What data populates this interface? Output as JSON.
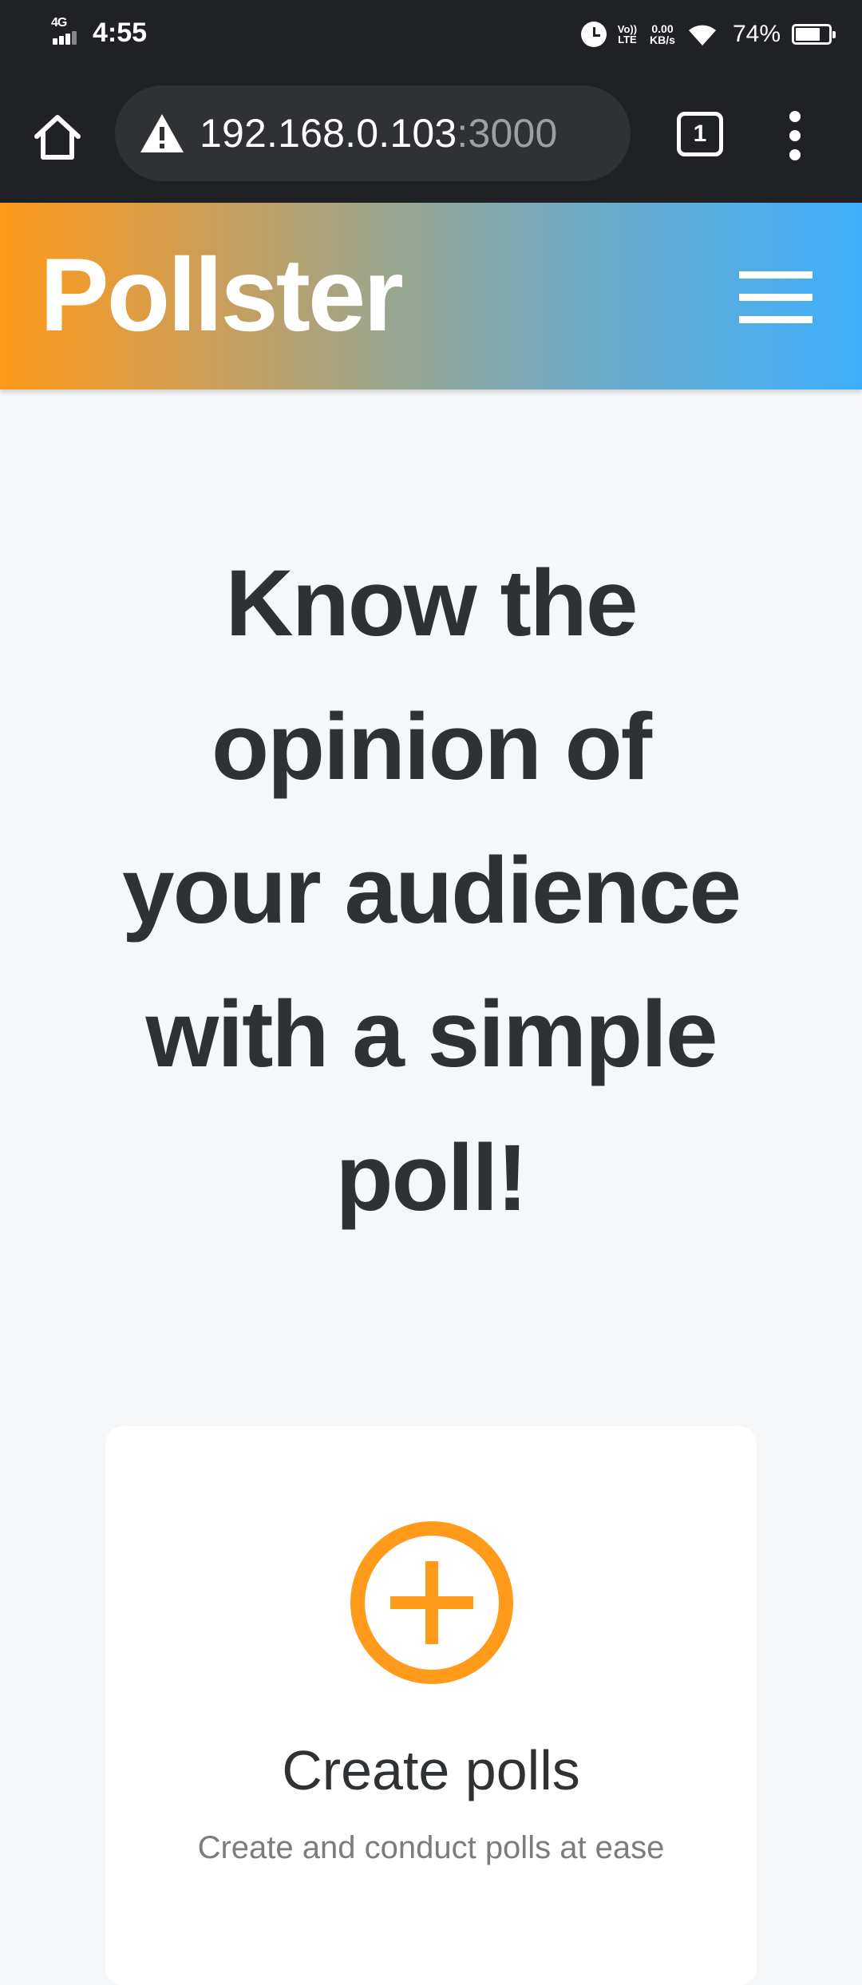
{
  "status_bar": {
    "network": "4G",
    "time": "4:55",
    "volte_top": "Vo))",
    "volte_bottom": "LTE",
    "speed_value": "0.00",
    "speed_unit": "KB/s",
    "battery_percent": "74%",
    "battery_level": 0.74
  },
  "browser": {
    "url_host": "192.168.0.103",
    "url_port": ":3000",
    "tab_count": "1"
  },
  "header": {
    "brand": "Pollster"
  },
  "hero": {
    "title": "Know the opinion of your audience with a simple poll!"
  },
  "feature": {
    "icon": "plus-circle-icon",
    "title": "Create polls",
    "description": "Create and conduct polls at ease"
  },
  "colors": {
    "accent": "#ff9a1a",
    "header_gradient_start": "#ff9a1a",
    "header_gradient_end": "#3eaefc",
    "text": "#2f3234"
  }
}
